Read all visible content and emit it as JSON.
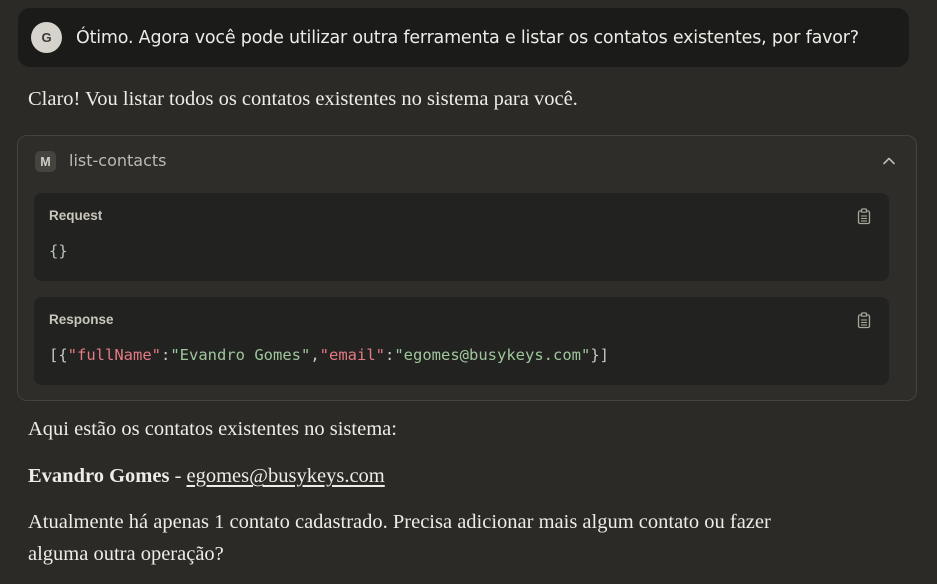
{
  "user_message": {
    "avatar_initial": "G",
    "text": "Ótimo. Agora você pode utilizar outra ferramenta e listar os contatos existentes, por favor?"
  },
  "assistant_intro": "Claro! Vou listar todos os contatos existentes no sistema para você.",
  "tool_call": {
    "badge": "M",
    "name": "list-contacts",
    "request": {
      "label": "Request",
      "body": "{}"
    },
    "response": {
      "label": "Response",
      "open": "[{",
      "key1": "\"fullName\"",
      "colon1": ":",
      "val1": "\"Evandro Gomes\"",
      "comma": ",",
      "key2": "\"email\"",
      "colon2": ":",
      "val2": "\"egomes@busykeys.com\"",
      "close": "}]"
    }
  },
  "assistant_result": {
    "heading": "Aqui estão os contatos existentes no sistema:",
    "contact_name": "Evandro Gomes",
    "separator": " - ",
    "contact_email": "egomes@busykeys.com",
    "followup_line1": "Atualmente há apenas 1 contato cadastrado. Precisa adicionar mais algum contato ou fazer",
    "followup_line2": "alguma outra operação?"
  },
  "colors": {
    "background": "#2b2a27",
    "user_bubble": "#1b1b19",
    "code_panel": "#222220",
    "json_key": "#e47a83",
    "json_string": "#9fc69c"
  }
}
